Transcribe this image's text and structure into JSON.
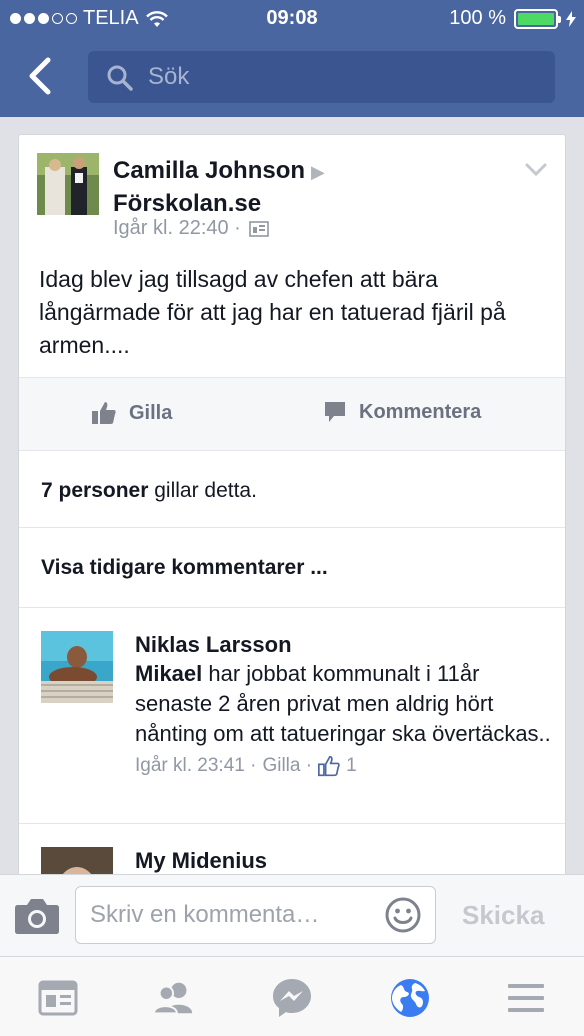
{
  "status_bar": {
    "carrier": "TELIA",
    "time": "09:08",
    "battery": "100 %",
    "signal_bars": 3,
    "signal_total": 5
  },
  "nav": {
    "search_placeholder": "Sök"
  },
  "post": {
    "author": "Camilla Johnson",
    "target": "Förskolan.se",
    "timestamp": "Igår kl. 22:40 ·",
    "text": "Idag blev jag tillsagd av chefen att bära långärmade för att jag har en tatuerad fjäril på armen....",
    "actions": {
      "like": "Gilla",
      "comment": "Kommentera"
    },
    "likes_count": "7 personer",
    "likes_suffix": " gillar detta.",
    "view_previous": "Visa tidigare kommentarer ..."
  },
  "comments": [
    {
      "name": "Niklas Larsson",
      "mention": "Mikael",
      "text": " har jobbat kommunalt i 11år senaste 2 åren privat men aldrig hört nånting om att tatueringar ska övertäckas..",
      "timestamp": "Igår kl. 23:41 ·",
      "like_label": "Gilla ·",
      "like_count": "1"
    },
    {
      "name": "My Midenius"
    }
  ],
  "composer": {
    "placeholder": "Skriv en kommenta…",
    "send_label": "Skicka"
  },
  "tabs": [
    "news-feed-icon",
    "friends-icon",
    "messenger-icon",
    "globe-icon",
    "menu-icon"
  ],
  "colors": {
    "header": "#4a66a0",
    "active_tab": "#3b7df0",
    "battery": "#4cd964"
  }
}
